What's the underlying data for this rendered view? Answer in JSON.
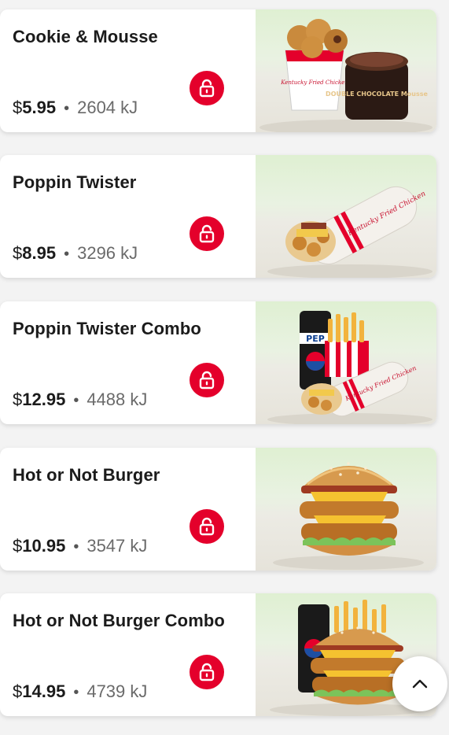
{
  "colors": {
    "accent": "#e4002b",
    "text": "#1b1b1b",
    "muted": "#6a6a6a"
  },
  "items": [
    {
      "name": "Cookie & Mousse",
      "currency": "$",
      "price": "5.95",
      "energy": "2604 kJ",
      "icon": "unlock-icon",
      "image": "cookie-and-mousse-photo",
      "packaging_text": [
        "Kentucky Fried Chicken",
        "DOUBLE CHOCOLATE Mousse"
      ]
    },
    {
      "name": "Poppin Twister",
      "currency": "$",
      "price": "8.95",
      "energy": "3296 kJ",
      "icon": "unlock-icon",
      "image": "twister-wrap-photo",
      "packaging_text": [
        "Kentucky Fried Chicken"
      ]
    },
    {
      "name": "Poppin Twister Combo",
      "currency": "$",
      "price": "12.95",
      "energy": "4488 kJ",
      "icon": "unlock-icon",
      "image": "twister-combo-photo",
      "packaging_text": [
        "PEP",
        "Kentucky Fried Chicken"
      ]
    },
    {
      "name": "Hot or Not Burger",
      "currency": "$",
      "price": "10.95",
      "energy": "3547 kJ",
      "icon": "unlock-icon",
      "image": "burger-photo",
      "packaging_text": []
    },
    {
      "name": "Hot or Not Burger Combo",
      "currency": "$",
      "price": "14.95",
      "energy": "4739 kJ",
      "icon": "unlock-icon",
      "image": "burger-combo-photo",
      "packaging_text": []
    }
  ],
  "scroll_top_icon": "chevron-up-icon"
}
